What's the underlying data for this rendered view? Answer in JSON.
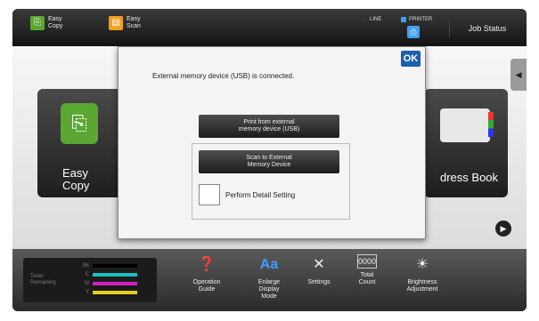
{
  "topbar": {
    "easy_copy": "Easy\nCopy",
    "easy_scan": "Easy\nScan",
    "line_label": "LINE",
    "printer_label": "PRINTER",
    "job_status": "Job Status"
  },
  "home": {
    "tile_left_label": "Easy\nCopy",
    "tile_right_label": "dress Book"
  },
  "dialog": {
    "message": "External memory device (USB) is connected.",
    "ok_label": "OK",
    "print_button": "Print from external\nmemory device (USB)",
    "scan_button": "Scan to External\nMemory Device",
    "detail_setting_label": "Perform Detail Setting"
  },
  "toner": {
    "title": "Toner\nRemaining",
    "channels": [
      "Bk",
      "C",
      "M",
      "Y"
    ],
    "colors": [
      "#000000",
      "#20c0c0",
      "#d020c0",
      "#e0d020"
    ]
  },
  "bottombar": {
    "items": [
      {
        "label": "Operation\nGuide",
        "icon": "book-question-icon"
      },
      {
        "label": "Enlarge\nDisplay\nMode",
        "icon": "enlarge-text-icon"
      },
      {
        "label": "Settings",
        "icon": "wrench-screwdriver-icon"
      },
      {
        "label": "Total\nCount",
        "icon": "counter-icon"
      },
      {
        "label": "Brightness\nAdjustment",
        "icon": "sun-icon"
      }
    ]
  },
  "colors": {
    "accent": "#1c5fb0",
    "page_dot_active": "#2a7de1",
    "easy_copy_green": "#5aa832"
  }
}
